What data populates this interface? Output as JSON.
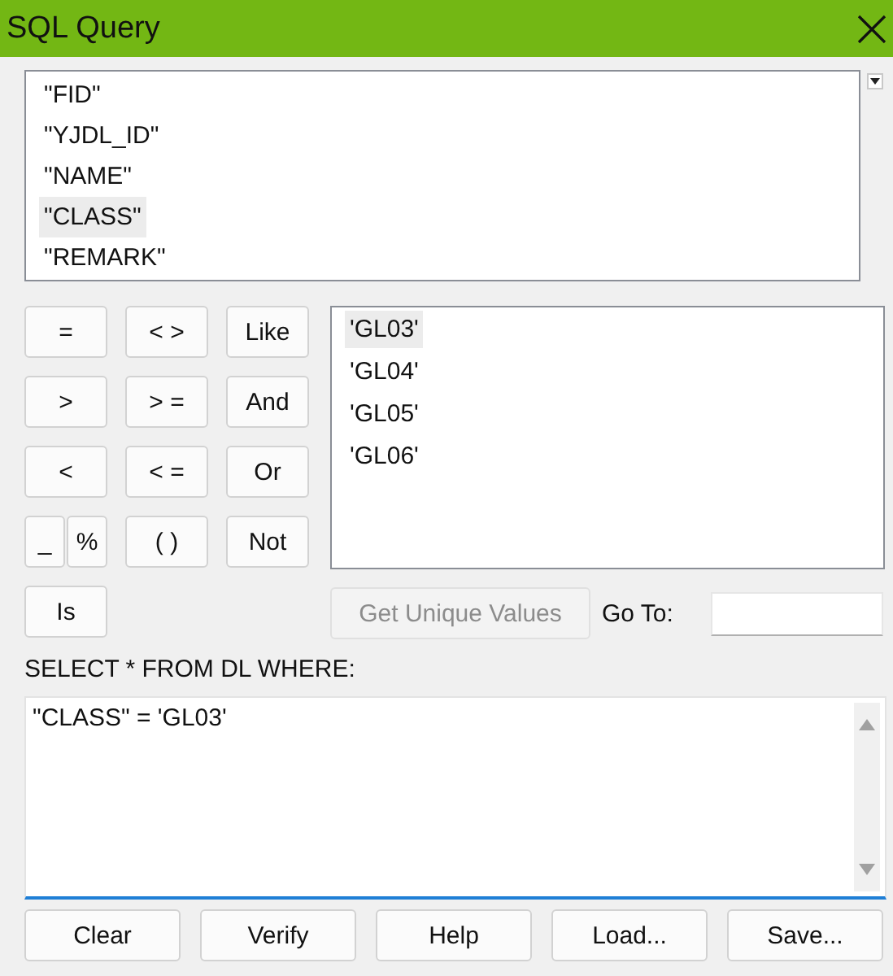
{
  "window": {
    "title": "SQL Query"
  },
  "fields": [
    {
      "label": "\"FID\"",
      "selected": false
    },
    {
      "label": "\"YJDL_ID\"",
      "selected": false
    },
    {
      "label": "\"NAME\"",
      "selected": false
    },
    {
      "label": "\"CLASS\"",
      "selected": true
    },
    {
      "label": "\"REMARK\"",
      "selected": false
    }
  ],
  "operators": [
    [
      [
        "="
      ],
      [
        "< >"
      ],
      [
        "Like"
      ]
    ],
    [
      [
        ">"
      ],
      [
        "> ="
      ],
      [
        "And"
      ]
    ],
    [
      [
        "<"
      ],
      [
        "< ="
      ],
      [
        "Or"
      ]
    ],
    [
      [
        "_",
        "%"
      ],
      [
        "( )"
      ],
      [
        "Not"
      ]
    ],
    [
      [
        "Is"
      ]
    ]
  ],
  "values": [
    {
      "label": "'GL03'",
      "selected": true
    },
    {
      "label": "'GL04'",
      "selected": false
    },
    {
      "label": "'GL05'",
      "selected": false
    },
    {
      "label": "'GL06'",
      "selected": false
    }
  ],
  "get_unique_values": {
    "label": "Get Unique Values",
    "disabled": true
  },
  "goto": {
    "label": "Go To:"
  },
  "where_label": "SELECT * FROM DL WHERE:",
  "expression": {
    "value": "\"CLASS\" = 'GL03'"
  },
  "buttons": [
    "Clear",
    "Verify",
    "Help",
    "Load...",
    "Save..."
  ]
}
